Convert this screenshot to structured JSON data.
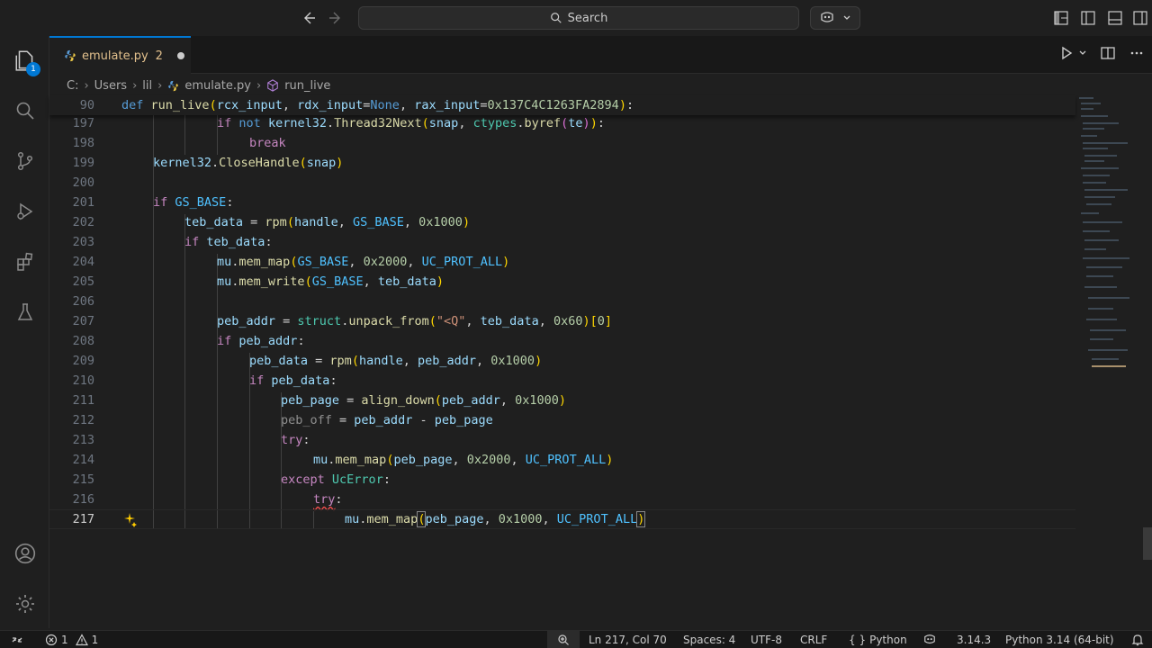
{
  "search": {
    "label": "Search"
  },
  "tab": {
    "filename": "emulate.py",
    "problems": "2"
  },
  "activity": {
    "explorer_badge": "1"
  },
  "breadcrumb": [
    "C:",
    "Users",
    "lil",
    "emulate.py",
    "run_live"
  ],
  "editor": {
    "lines": [
      {
        "n": "90",
        "sticky": true
      },
      {
        "n": "197"
      },
      {
        "n": "198"
      },
      {
        "n": "199"
      },
      {
        "n": "200"
      },
      {
        "n": "201"
      },
      {
        "n": "202"
      },
      {
        "n": "203"
      },
      {
        "n": "204"
      },
      {
        "n": "205"
      },
      {
        "n": "206"
      },
      {
        "n": "207"
      },
      {
        "n": "208"
      },
      {
        "n": "209"
      },
      {
        "n": "210"
      },
      {
        "n": "211"
      },
      {
        "n": "212"
      },
      {
        "n": "213"
      },
      {
        "n": "214"
      },
      {
        "n": "215"
      },
      {
        "n": "216"
      },
      {
        "n": "217",
        "active": true
      }
    ],
    "code": {
      "l90_def": "def",
      "l90_fn": "run_live",
      "l90_p1": "rcx_input",
      "l90_p2": "rdx_input",
      "l90_none": "None",
      "l90_p3": "rax_input",
      "l90_hex": "0x137C4C1263FA2894",
      "l197_if": "if",
      "l197_not": "not",
      "l197_obj": "kernel32",
      "l197_fn": "Thread32Next",
      "l197_a1": "snap",
      "l197_mod": "ctypes",
      "l197_fn2": "byref",
      "l197_a2": "te",
      "l198": "break",
      "l199_obj": "kernel32",
      "l199_fn": "CloseHandle",
      "l199_a": "snap",
      "l201_if": "if",
      "l201_c": "GS_BASE",
      "l202_v": "teb_data",
      "l202_fn": "rpm",
      "l202_a1": "handle",
      "l202_a2": "GS_BASE",
      "l202_n": "0x1000",
      "l203_if": "if",
      "l203_v": "teb_data",
      "l204_o": "mu",
      "l204_fn": "mem_map",
      "l204_a1": "GS_BASE",
      "l204_n": "0x2000",
      "l204_a2": "UC_PROT_ALL",
      "l205_o": "mu",
      "l205_fn": "mem_write",
      "l205_a1": "GS_BASE",
      "l205_a2": "teb_data",
      "l207_v": "peb_addr",
      "l207_mod": "struct",
      "l207_fn": "unpack_from",
      "l207_s": "\"<Q\"",
      "l207_a": "teb_data",
      "l207_n": "0x60",
      "l207_i": "0",
      "l208_if": "if",
      "l208_v": "peb_addr",
      "l209_v": "peb_data",
      "l209_fn": "rpm",
      "l209_a1": "handle",
      "l209_a2": "peb_addr",
      "l209_n": "0x1000",
      "l210_if": "if",
      "l210_v": "peb_data",
      "l211_v": "peb_page",
      "l211_fn": "align_down",
      "l211_a": "peb_addr",
      "l211_n": "0x1000",
      "l212_v": "peb_off",
      "l212_a": "peb_addr",
      "l212_b": "peb_page",
      "l213": "try",
      "l214_o": "mu",
      "l214_fn": "mem_map",
      "l214_a": "peb_page",
      "l214_n": "0x2000",
      "l214_c": "UC_PROT_ALL",
      "l215_ex": "except",
      "l215_cls": "UcError",
      "l216": "try",
      "l217_o": "mu",
      "l217_fn": "mem_map",
      "l217_a": "peb_page",
      "l217_n": "0x1000",
      "l217_c": "UC_PROT_ALL"
    }
  },
  "status": {
    "errors": "1",
    "warnings": "1",
    "position": "Ln 217, Col 70",
    "spaces": "Spaces: 4",
    "encoding": "UTF-8",
    "eol": "CRLF",
    "language": "Python",
    "language_prefix": "{ }",
    "version": "3.14.3",
    "interpreter": "Python 3.14 (64-bit)"
  },
  "colors": {
    "accent": "#0078d4",
    "error": "#f14c4c",
    "modified": "#e2c08d"
  },
  "icons": [
    "arrow-left-icon",
    "arrow-right-icon",
    "search-icon",
    "copilot-icon",
    "layout-icons",
    "files-icon",
    "search-icon",
    "source-control-icon",
    "run-debug-icon",
    "extensions-icon",
    "testing-icon",
    "account-icon",
    "settings-gear-icon",
    "run-icon",
    "split-editor-icon",
    "more-icon",
    "lightbulb-icon",
    "remote-icon",
    "error-icon",
    "warning-icon",
    "zoom-icon",
    "copilot-status-icon",
    "bell-icon"
  ]
}
